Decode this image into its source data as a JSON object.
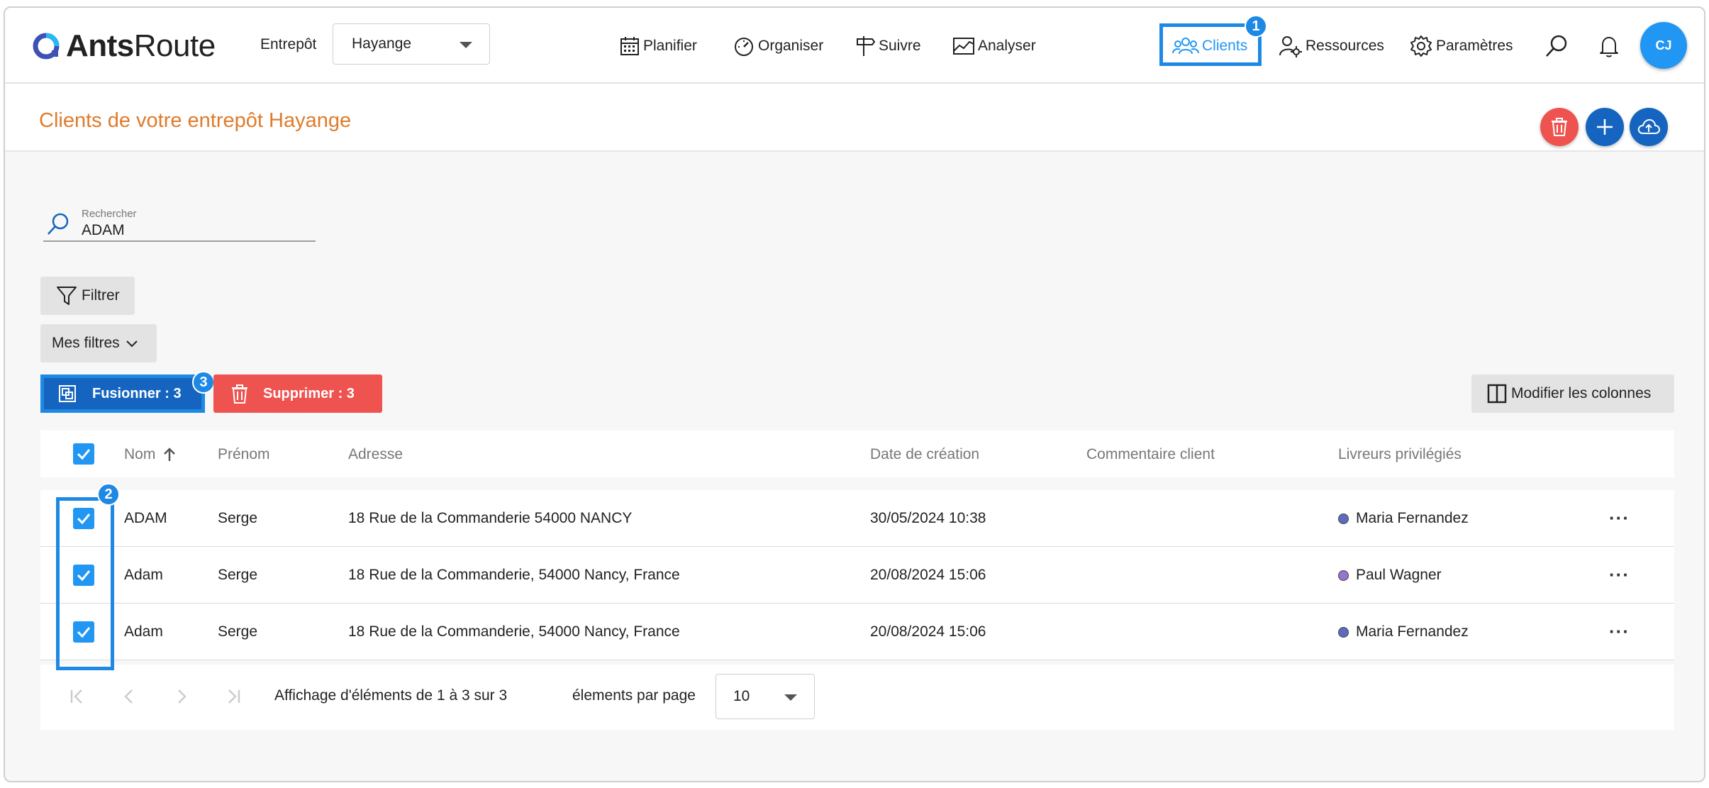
{
  "app": {
    "logo_primary": "Ants",
    "logo_secondary": "Route"
  },
  "topbar": {
    "depot_label": "Entrepôt",
    "depot_value": "Hayange",
    "nav": {
      "plan": "Planifier",
      "organize": "Organiser",
      "track": "Suivre",
      "analyze": "Analyser",
      "clients": "Clients",
      "resources": "Ressources",
      "settings": "Paramètres"
    },
    "avatar_initials": "CJ"
  },
  "annotations": {
    "clients": "1",
    "checkboxes": "2",
    "merge": "3"
  },
  "page": {
    "title": "Clients de votre entrepôt Hayange"
  },
  "search": {
    "label": "Rechercher",
    "value": "ADAM"
  },
  "toolbar": {
    "filter_label": "Filtrer",
    "my_filters_label": "Mes filtres",
    "merge_label": "Fusionner : 3",
    "delete_label": "Supprimer : 3",
    "columns_label": "Modifier les colonnes"
  },
  "table": {
    "headers": {
      "name": "Nom",
      "firstname": "Prénom",
      "address": "Adresse",
      "created": "Date de création",
      "comment": "Commentaire client",
      "drivers": "Livreurs privilégiés"
    },
    "rows": [
      {
        "name": "ADAM",
        "firstname": "Serge",
        "address": "18 Rue de la Commanderie 54000 NANCY",
        "created": "30/05/2024 10:38",
        "comment": "",
        "driver": "Maria Fernandez",
        "driver_color": "#5c6bc0"
      },
      {
        "name": "Adam",
        "firstname": "Serge",
        "address": "18 Rue de la Commanderie, 54000 Nancy, France",
        "created": "20/08/2024 15:06",
        "comment": "",
        "driver": "Paul Wagner",
        "driver_color": "#9575cd"
      },
      {
        "name": "Adam",
        "firstname": "Serge",
        "address": "18 Rue de la Commanderie, 54000 Nancy, France",
        "created": "20/08/2024 15:06",
        "comment": "",
        "driver": "Maria Fernandez",
        "driver_color": "#5c6bc0"
      }
    ]
  },
  "pagination": {
    "summary": "Affichage d'éléments de 1 à 3 sur 3",
    "per_page_label": "élements par page",
    "per_page_value": "10"
  },
  "colors": {
    "accent": "#2196f3",
    "title_orange": "#e07b2a",
    "danger": "#ef5350",
    "primary_dark": "#1565c0"
  }
}
